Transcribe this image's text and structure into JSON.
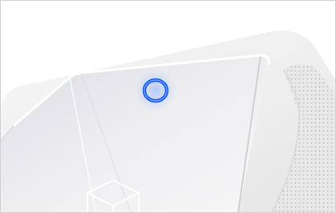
{
  "image": {
    "subject": "drive-product-photo",
    "colors": {
      "background": "#ffffff",
      "bumper": "#f1f1f1",
      "panel": "#e9e9ec",
      "led_ring": "#1f63f0",
      "led_glow": "#8fb3ff"
    },
    "icons": [
      "status-led-ring-icon",
      "cube-logo-icon"
    ]
  }
}
